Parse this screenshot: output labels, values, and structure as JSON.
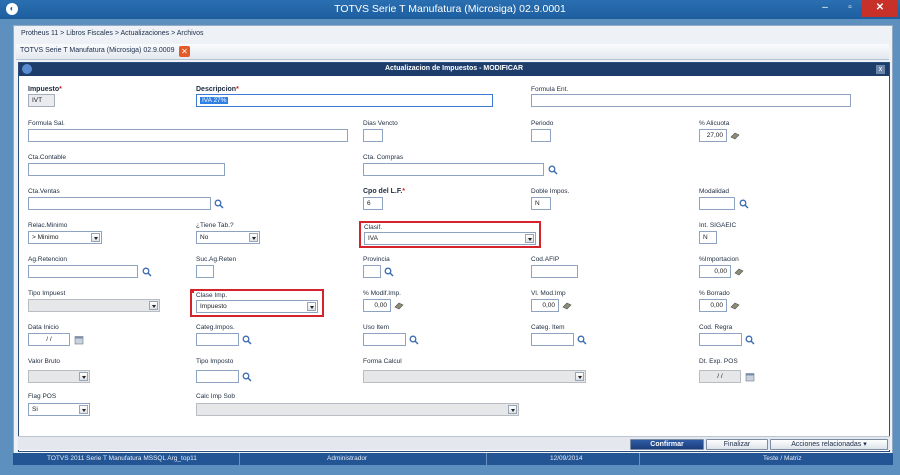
{
  "window": {
    "title": "TOTVS Serie T Manufatura (Microsiga) 02.9.0001",
    "min": "–",
    "max": "▫",
    "close": "✕"
  },
  "breadcrumb": "Protheus 11 > Libros Fiscales > Actualizaciones > Archivos",
  "tab": {
    "label": "TOTVS Serie T Manufatura (Microsiga) 02.9.0009",
    "close": "✕"
  },
  "dialog": {
    "title": "Actualizacion de Impuestos - MODIFICAR",
    "close": "x"
  },
  "fields": {
    "impuesto": {
      "label": "Impuesto",
      "req": "*",
      "value": "IVT"
    },
    "descripcion": {
      "label": "Descripcion",
      "req": "*",
      "value": "IVA 27%"
    },
    "formula_ent": {
      "label": "Formula Ent.",
      "value": ""
    },
    "formula_sal": {
      "label": "Formula Sal.",
      "value": ""
    },
    "dias_vencto": {
      "label": "Dias Vencto",
      "value": ""
    },
    "periodo": {
      "label": "Periodo",
      "value": ""
    },
    "alicuota": {
      "label": "% Alicuota",
      "value": "27,00"
    },
    "cta_contable": {
      "label": "Cta.Contable",
      "value": ""
    },
    "cta_compras": {
      "label": "Cta. Compras",
      "value": ""
    },
    "cta_ventas": {
      "label": "Cta.Ventas",
      "value": ""
    },
    "cpo_lf": {
      "label": "Cpo del L.F.",
      "req": "*",
      "value": "6"
    },
    "doble_impos": {
      "label": "Doble Impos.",
      "value": "N"
    },
    "modalidad": {
      "label": "Modalidad",
      "value": ""
    },
    "relac_minimo": {
      "label": "Relac.Minimo",
      "value": "> Minimo"
    },
    "tiene_tab": {
      "label": "¿Tiene Tab.?",
      "value": "No"
    },
    "clasif": {
      "label": "Clasif.",
      "value": "IVA"
    },
    "int_sigaeic": {
      "label": "Int. SIGAEIC",
      "value": "N"
    },
    "ag_retencion": {
      "label": "Ag.Retencion",
      "value": ""
    },
    "suc_ag_reten": {
      "label": "Suc.Ag.Reten",
      "value": ""
    },
    "provincia": {
      "label": "Provincia",
      "value": ""
    },
    "cod_afip": {
      "label": "Cod.AFIP",
      "value": ""
    },
    "importacion": {
      "label": "%Importacion",
      "value": "0,00"
    },
    "tipo_impuest": {
      "label": "Tipo Impuest",
      "value": ""
    },
    "clase_imp": {
      "label": "Clase Imp.",
      "value": "Impuesto"
    },
    "modif_imp": {
      "label": "% Modif.Imp.",
      "value": "0,00"
    },
    "vl_mod_imp": {
      "label": "Vl. Mod.Imp",
      "value": "0,00"
    },
    "borrado": {
      "label": "% Borrado",
      "value": "0,00"
    },
    "data_inicio": {
      "label": "Data Inicio",
      "value": "/ /"
    },
    "categ_impos": {
      "label": "Categ.Impos.",
      "value": ""
    },
    "uso_item": {
      "label": "Uso Item",
      "value": ""
    },
    "categ_item": {
      "label": "Categ. Item",
      "value": ""
    },
    "cod_regra": {
      "label": "Cod. Regra",
      "value": ""
    },
    "valor_bruto": {
      "label": "Valor Bruto",
      "value": ""
    },
    "tipo_imposto": {
      "label": "Tipo Imposto",
      "value": ""
    },
    "forma_calcul": {
      "label": "Forma Calcul",
      "value": ""
    },
    "dt_exp_pos": {
      "label": "Dt. Exp. POS",
      "value": "/ /"
    },
    "flag_pos": {
      "label": "Flag POS",
      "value": "Si"
    },
    "calc_imp_sob": {
      "label": "Calc Imp Sob",
      "value": ""
    }
  },
  "buttons": {
    "confirmar": "Confirmar",
    "finalizar": "Finalizar",
    "acciones": "Acciones relacionadas"
  },
  "statusbar": {
    "app": "TOTVS 2011 Serie T Manufatura MSSQL Arg_top11",
    "user": "Administrador",
    "date": "12/09/2014",
    "branch": "Teste / Matriz"
  },
  "colors": {
    "accent": "#1f3d6a",
    "highlight": "#d4232b"
  }
}
